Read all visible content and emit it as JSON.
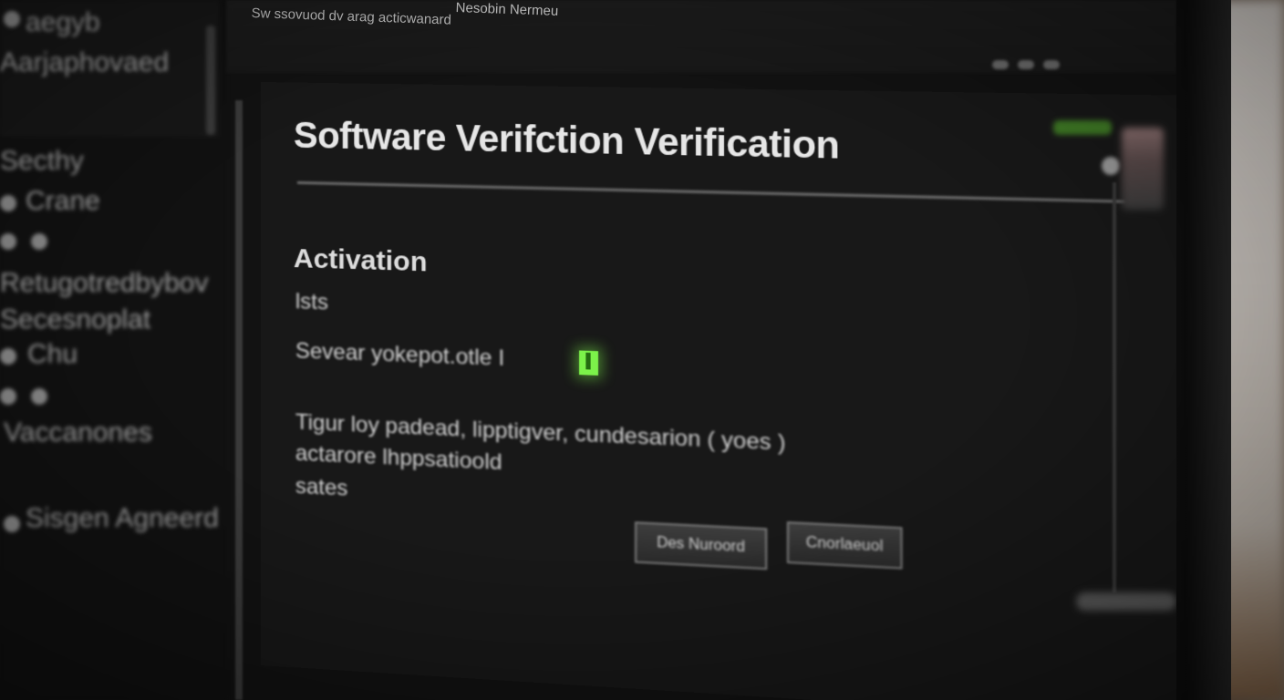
{
  "window": {
    "path_text": "Sw ssovuod dv arag acticwanard",
    "title_text": "Nesobin Nermeu"
  },
  "sidebar": {
    "items": [
      {
        "label": "aegyb"
      },
      {
        "label": "Aarjaphovaed"
      },
      {
        "label": "Secthy"
      },
      {
        "label": "Crane"
      },
      {
        "label": "Retugotredbybov"
      },
      {
        "label": "Secesnoplat"
      },
      {
        "label": "Chu"
      },
      {
        "label": "Vaccanones"
      },
      {
        "label": "Sisgen Agneerd"
      }
    ]
  },
  "dialog": {
    "title": "Software Verifction Verification",
    "section_heading": "Activation",
    "line_1": "lsts",
    "line_2": "Sevear yokepot.otle  I",
    "desc_line_1": "Tigur loy padead, lipptigver, cundesarion ( yoes )",
    "desc_line_2": "actarore lhppsatioold",
    "desc_line_3": "sates",
    "status_color": "#7cf24a"
  },
  "buttons": {
    "primary_label": "Des Nuroord",
    "secondary_label": "Cnorlaeuol"
  },
  "icons": {
    "status_indicator": "green-check-indicator",
    "window_controls": [
      "minimize-icon",
      "maximize-icon",
      "close-icon"
    ]
  }
}
